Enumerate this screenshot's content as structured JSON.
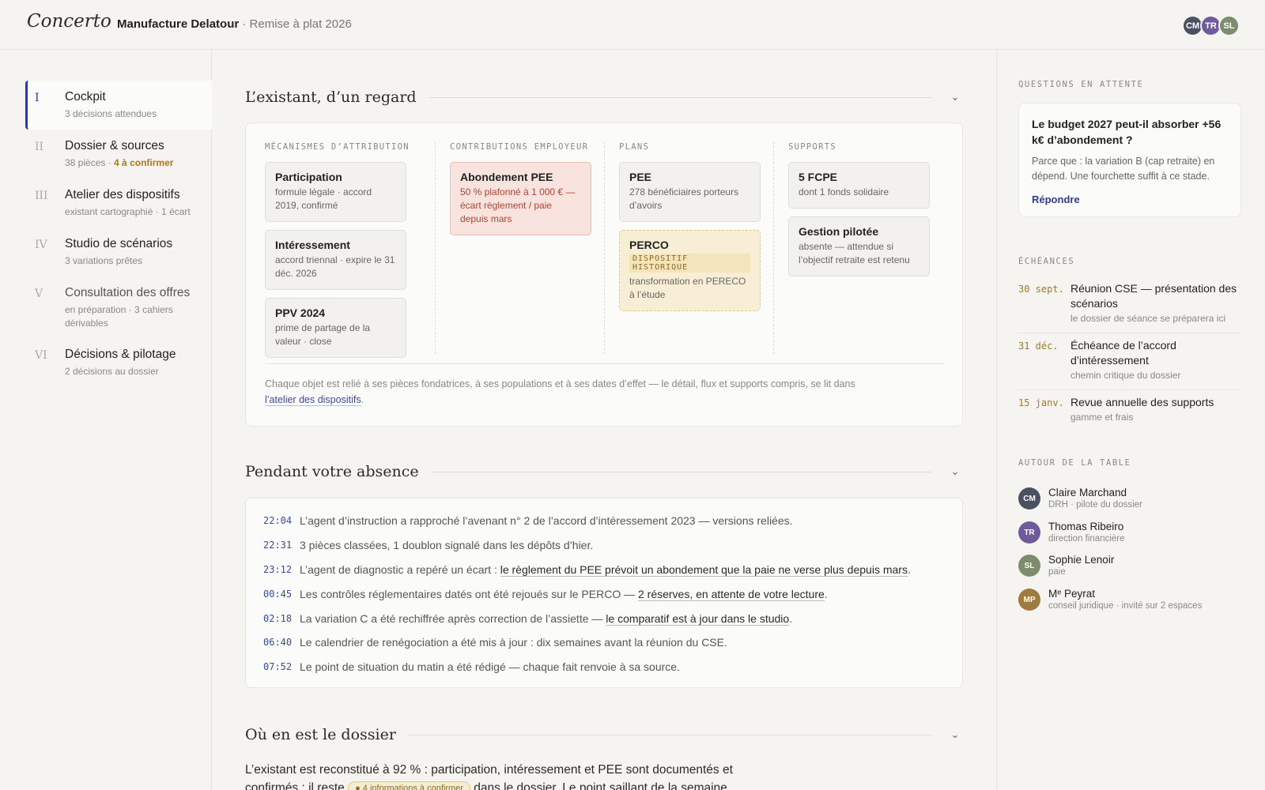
{
  "header": {
    "logo": "Concerto",
    "client": "Manufacture Delatour",
    "separator": "·",
    "project": "Remise à plat 2026",
    "avatars": [
      {
        "initials": "CM",
        "color": "#4a5160"
      },
      {
        "initials": "TR",
        "color": "#6f5b9a"
      },
      {
        "initials": "SL",
        "color": "#7b8d6c"
      }
    ]
  },
  "sidebar": {
    "items": [
      {
        "num": "I",
        "label": "Cockpit",
        "sub": "3 décisions attendues",
        "active": true
      },
      {
        "num": "II",
        "label": "Dossier & sources",
        "sub": "38 pièces",
        "warn": "4 à confirmer"
      },
      {
        "num": "III",
        "label": "Atelier des dispositifs",
        "sub": "existant cartographié · 1 écart"
      },
      {
        "num": "IV",
        "label": "Studio de scénarios",
        "sub": "3 variations prêtes"
      },
      {
        "num": "V",
        "label": "Consultation des offres",
        "sub": "en préparation · 3 cahiers dérivables"
      },
      {
        "num": "VI",
        "label": "Décisions & pilotage",
        "sub": "2 décisions au dossier"
      }
    ]
  },
  "existing": {
    "title": "L’existant, d’un regard",
    "columns": [
      {
        "head": "MÉCANISMES D’ATTRIBUTION",
        "cards": [
          {
            "title": "Participation",
            "sub": "formule légale · accord 2019, confirmé"
          },
          {
            "title": "Intéressement",
            "sub": "accord triennal · expire le 31 déc. 2026"
          },
          {
            "title": "PPV 2024",
            "sub": "prime de partage de la valeur · close"
          }
        ]
      },
      {
        "head": "CONTRIBUTIONS EMPLOYEUR",
        "cards": [
          {
            "title": "Abondement PEE",
            "sub": "50 % plafonné à 1 000 € — écart règlement / paie depuis mars",
            "variant": "red"
          }
        ]
      },
      {
        "head": "PLANS",
        "cards": [
          {
            "title": "PEE",
            "sub": "278 bénéficiaires porteurs d’avoirs"
          },
          {
            "title": "PERCO",
            "tag": "DISPOSITIF HISTORIQUE",
            "sub": "transformation en PERECO à l’étude",
            "variant": "amber"
          }
        ]
      },
      {
        "head": "SUPPORTS",
        "cards": [
          {
            "title": "5 FCPE",
            "sub": "dont 1 fonds solidaire"
          },
          {
            "title": "Gestion pilotée",
            "sub": "absente — attendue si l’objectif retraite est retenu"
          }
        ]
      }
    ],
    "footer_text": "Chaque objet est relié à ses pièces fondatrices, à ses populations et à ses dates d’effet — le détail, flux et supports compris, se lit dans",
    "footer_link": "l’atelier des dispositifs",
    "footer_end": "."
  },
  "absence": {
    "title": "Pendant votre absence",
    "log": [
      {
        "time": "22:04",
        "text": "L’agent d’instruction a rapproché l’avenant n° 2 de l’accord d’intéressement 2023 — versions reliées.",
        "link": "",
        "end": ""
      },
      {
        "time": "22:31",
        "text": "3 pièces classées, 1 doublon signalé dans les dépôts d’hier.",
        "link": "",
        "end": ""
      },
      {
        "time": "23:12",
        "text": "L’agent de diagnostic a repéré un écart : ",
        "link": "le règlement du PEE prévoit un abondement que la paie ne verse plus depuis mars",
        "end": "."
      },
      {
        "time": "00:45",
        "text": "Les contrôles réglementaires datés ont été rejoués sur le PERCO — ",
        "link": "2 réserves, en attente de votre lecture",
        "end": "."
      },
      {
        "time": "02:18",
        "text": "La variation C a été rechiffrée après correction de l’assiette — ",
        "link": "le comparatif est à jour dans le studio",
        "end": "."
      },
      {
        "time": "06:40",
        "text": "Le calendrier de renégociation a été mis à jour : dix semaines avant la réunion du CSE.",
        "link": "",
        "end": ""
      },
      {
        "time": "07:52",
        "text": "Le point de situation du matin a été rédigé — chaque fait renvoie à sa source.",
        "link": "",
        "end": ""
      }
    ]
  },
  "status": {
    "title": "Où en est le dossier",
    "text": "L’existant est reconstitué à 92 % : participation, intéressement et PEE sont documentés et confirmés ; il reste",
    "pill": "● 4 informations à confirmer",
    "text_end": "dans le dossier. Le point saillant de la semaine"
  },
  "rail": {
    "questions_head": "QUESTIONS EN ATTENTE",
    "question": {
      "title": "Le budget 2027 peut-il absorber +56 k€ d’abondement ?",
      "body": "Parce que : la variation B (cap retraite) en dépend. Une fourchette suffit à ce stade.",
      "action": "Répondre"
    },
    "dues_head": "ÉCHÉANCES",
    "dues": [
      {
        "date": "30 sept.",
        "title": "Réunion CSE — présentation des scénarios",
        "sub": "le dossier de séance se préparera ici"
      },
      {
        "date": "31 déc.",
        "title": "Échéance de l’accord d’intéressement",
        "sub": "chemin critique du dossier"
      },
      {
        "date": "15 janv.",
        "title": "Revue annuelle des supports",
        "sub": "gamme et frais"
      }
    ],
    "people_head": "AUTOUR DE LA TABLE",
    "people": [
      {
        "initials": "CM",
        "name": "Claire Marchand",
        "role": "DRH · pilote du dossier",
        "color": "#4a5160"
      },
      {
        "initials": "TR",
        "name": "Thomas Ribeiro",
        "role": "direction financière",
        "color": "#6f5b9a"
      },
      {
        "initials": "SL",
        "name": "Sophie Lenoir",
        "role": "paie",
        "color": "#7b8d6c"
      },
      {
        "initials": "MP",
        "name": "Mᵉ Peyrat",
        "role": "conseil juridique · invité sur 2 espaces",
        "color": "#a07a3e"
      }
    ]
  }
}
